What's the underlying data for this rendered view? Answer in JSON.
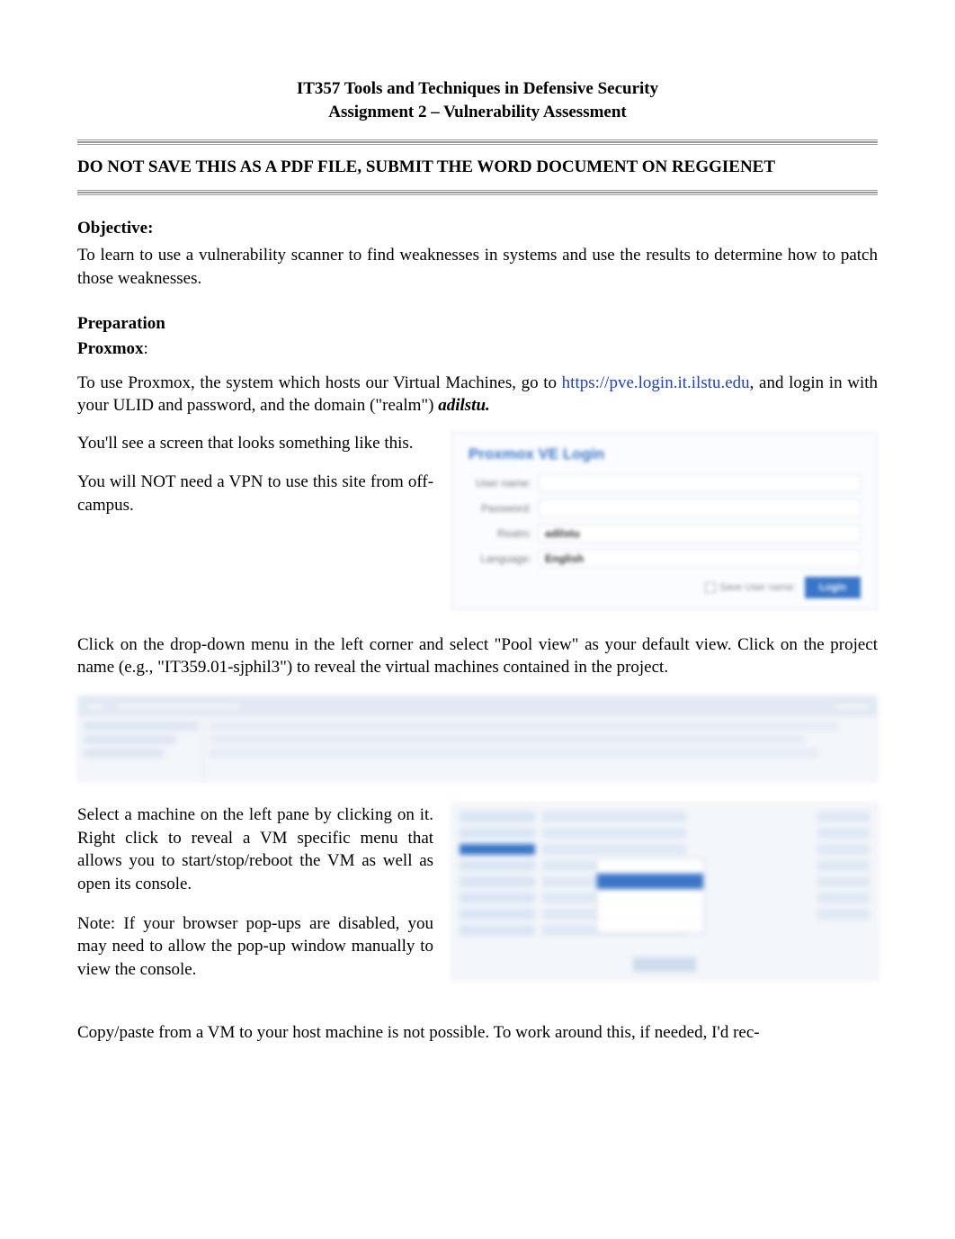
{
  "header": {
    "course_title": "IT357 Tools and Techniques in Defensive Security",
    "assignment_title": "Assignment 2 – Vulnerability Assessment"
  },
  "warning": "DO NOT SAVE THIS AS A PDF FILE, SUBMIT THE WORD DOCUMENT ON REGGIENET",
  "objective": {
    "heading": "Objective:",
    "text": "To learn to use a vulnerability scanner to find weaknesses in systems and use the results to determine how to patch those weaknesses."
  },
  "preparation_heading": "Preparation",
  "proxmox": {
    "label": "Proxmox",
    "colon": ":",
    "intro_pre": "To use Proxmox, the system which hosts our Virtual Machines, go to ",
    "url_text": "https://pve.login.it.ilstu.edu",
    "intro_post": ", and login in with your ULID and password, and the domain (\"realm\") ",
    "realm": "adilstu."
  },
  "login_left": {
    "p1": "You'll see a screen that looks something like this.",
    "p2": "You will NOT need a VPN to use this site from off-campus."
  },
  "login_box": {
    "title": "Proxmox VE Login",
    "username_label": "User name:",
    "password_label": "Password:",
    "realm_label": "Realm:",
    "realm_value": "adilstu",
    "language_label": "Language:",
    "language_value": "English",
    "save_label": "Save User name:",
    "login_button": "Login"
  },
  "pool_view_text": "Click on the drop-down menu in the left corner and select \"Pool view\" as your default view. Click on the project name (e.g., \"IT359.01-sjphil3\") to reveal the virtual machines contained in the project.",
  "vm_left": {
    "p1": "Select a machine on the left pane by clicking on it.  Right click to reveal a VM specific menu that allows you to start/stop/reboot the VM as well as open its console.",
    "p2": "Note: If your browser pop-ups are disabled, you may need to allow the pop-up window manually to view the console."
  },
  "copy_paste_text": "Copy/paste from a VM to your host machine is not possible.   To work around this, if needed, I'd rec-"
}
